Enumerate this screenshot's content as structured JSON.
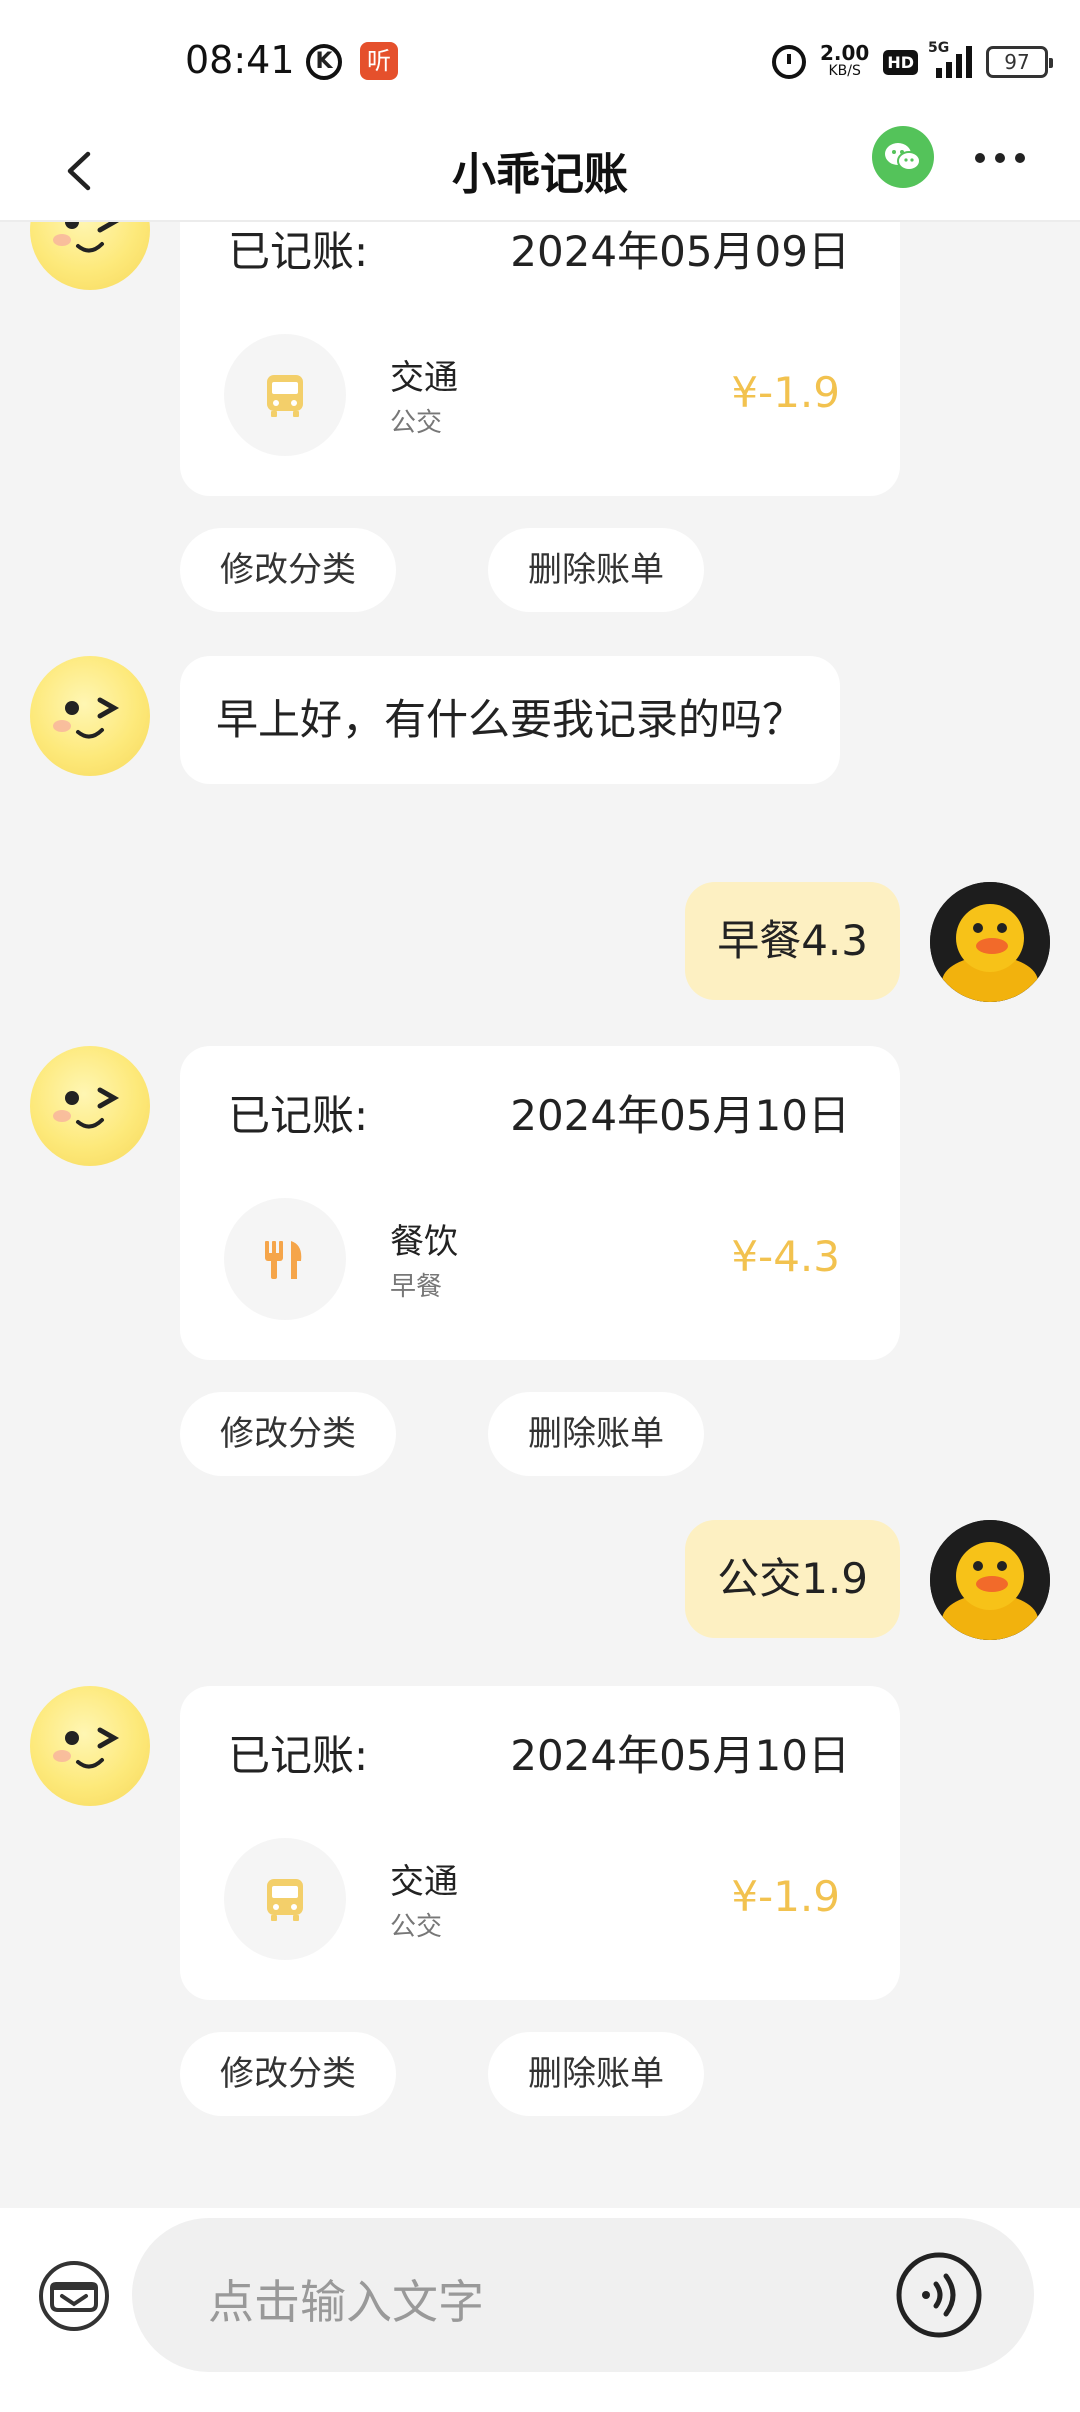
{
  "status_bar": {
    "time": "08:41",
    "k_icon": "K",
    "ting_icon": "听",
    "speed_value": "2.00",
    "speed_unit": "KB/S",
    "hd": "HD",
    "network": "5G",
    "battery": "97"
  },
  "header": {
    "title": "小乖记账"
  },
  "chat": {
    "record_label": "已记账:",
    "modify_label": "修改分类",
    "delete_label": "删除账单",
    "records": [
      {
        "date": "2024年05月09日",
        "category": "交通",
        "sub": "公交",
        "amount": "¥-1.9",
        "icon": "bus-icon"
      },
      {
        "date": "2024年05月10日",
        "category": "餐饮",
        "sub": "早餐",
        "amount": "¥-4.3",
        "icon": "fork-knife-icon"
      },
      {
        "date": "2024年05月10日",
        "category": "交通",
        "sub": "公交",
        "amount": "¥-1.9",
        "icon": "bus-icon"
      }
    ],
    "bot_message": "早上好，有什么要我记录的吗？",
    "user_messages": [
      "早餐4.3",
      "公交1.9"
    ]
  },
  "input": {
    "placeholder": "点击输入文字"
  },
  "colors": {
    "accent_amount": "#f2c24f",
    "user_bubble": "#fdf0c2",
    "wechat_green": "#54c35a"
  }
}
